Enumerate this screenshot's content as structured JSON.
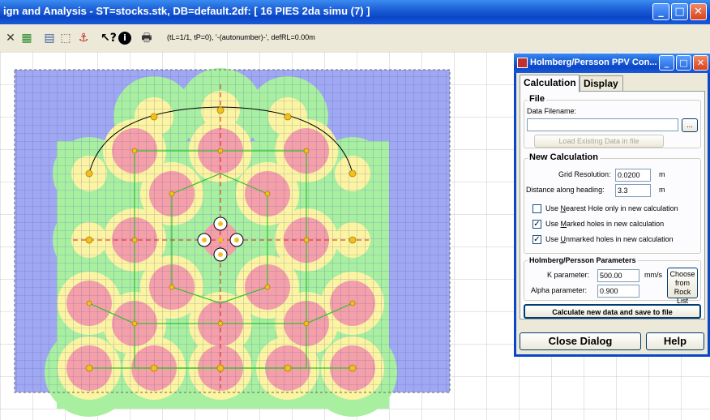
{
  "window": {
    "title": "ign and Analysis - ST=stocks.stk, DB=default.2df: [ 16 PIES 2da simu (7) ]",
    "minimize_icon": "minimize-icon",
    "maximize_icon": "maximize-icon",
    "close_icon": "close-icon"
  },
  "toolbar": {
    "status_text": "(tL=1/1, tP=0), '-(autonumber)-', defRL=0.00m",
    "icons": [
      "grid-x-icon",
      "chart-icon",
      "layers-icon",
      "select-icon",
      "anchor-icon",
      "help-pointer-icon",
      "info-icon",
      "print-icon"
    ]
  },
  "colors": {
    "accent": "#0a47c8",
    "contour_outer": "#9fa8f0",
    "contour_green": "#a8f0a0",
    "contour_yellow": "#fcf4a0",
    "contour_pink": "#f5a0a8",
    "hole": "#f0c020"
  },
  "dialog": {
    "title": "Holmberg/Persson PPV Con...",
    "tabs": [
      "Calculation",
      "Display"
    ],
    "file": {
      "group_label": "File",
      "data_filename_label": "Data Filename:",
      "data_filename_value": "",
      "browse_label": "...",
      "load_button": "Load Existing Data in file"
    },
    "new_calc": {
      "group_label": "New Calculation",
      "grid_resolution_label": "Grid Resolution:",
      "grid_resolution_value": "0.0200",
      "grid_resolution_unit": "m",
      "distance_label": "Distance along heading:",
      "distance_value": "3.3",
      "distance_unit": "m",
      "checks": [
        {
          "label_pre": "Use ",
          "label_u": "N",
          "label_post": "earest Hole only in new calculation",
          "checked": false
        },
        {
          "label_pre": "Use ",
          "label_u": "M",
          "label_post": "arked holes in new calculation",
          "checked": true
        },
        {
          "label_pre": "Use ",
          "label_u": "U",
          "label_post": "nmarked holes in new calculation",
          "checked": true
        }
      ]
    },
    "params": {
      "group_label": "Holmberg/Persson Parameters",
      "k_label": "K parameter:",
      "k_value": "500.00",
      "k_unit": "mm/s",
      "alpha_label": "Alpha parameter:",
      "alpha_value": "0.900",
      "choose_button_l1": "Choose",
      "choose_button_l2": "from Rock",
      "choose_button_l3": "List"
    },
    "calc_button": "Calculate new data and save to file",
    "close_button": "Close Dialog",
    "help_button": "Help"
  }
}
